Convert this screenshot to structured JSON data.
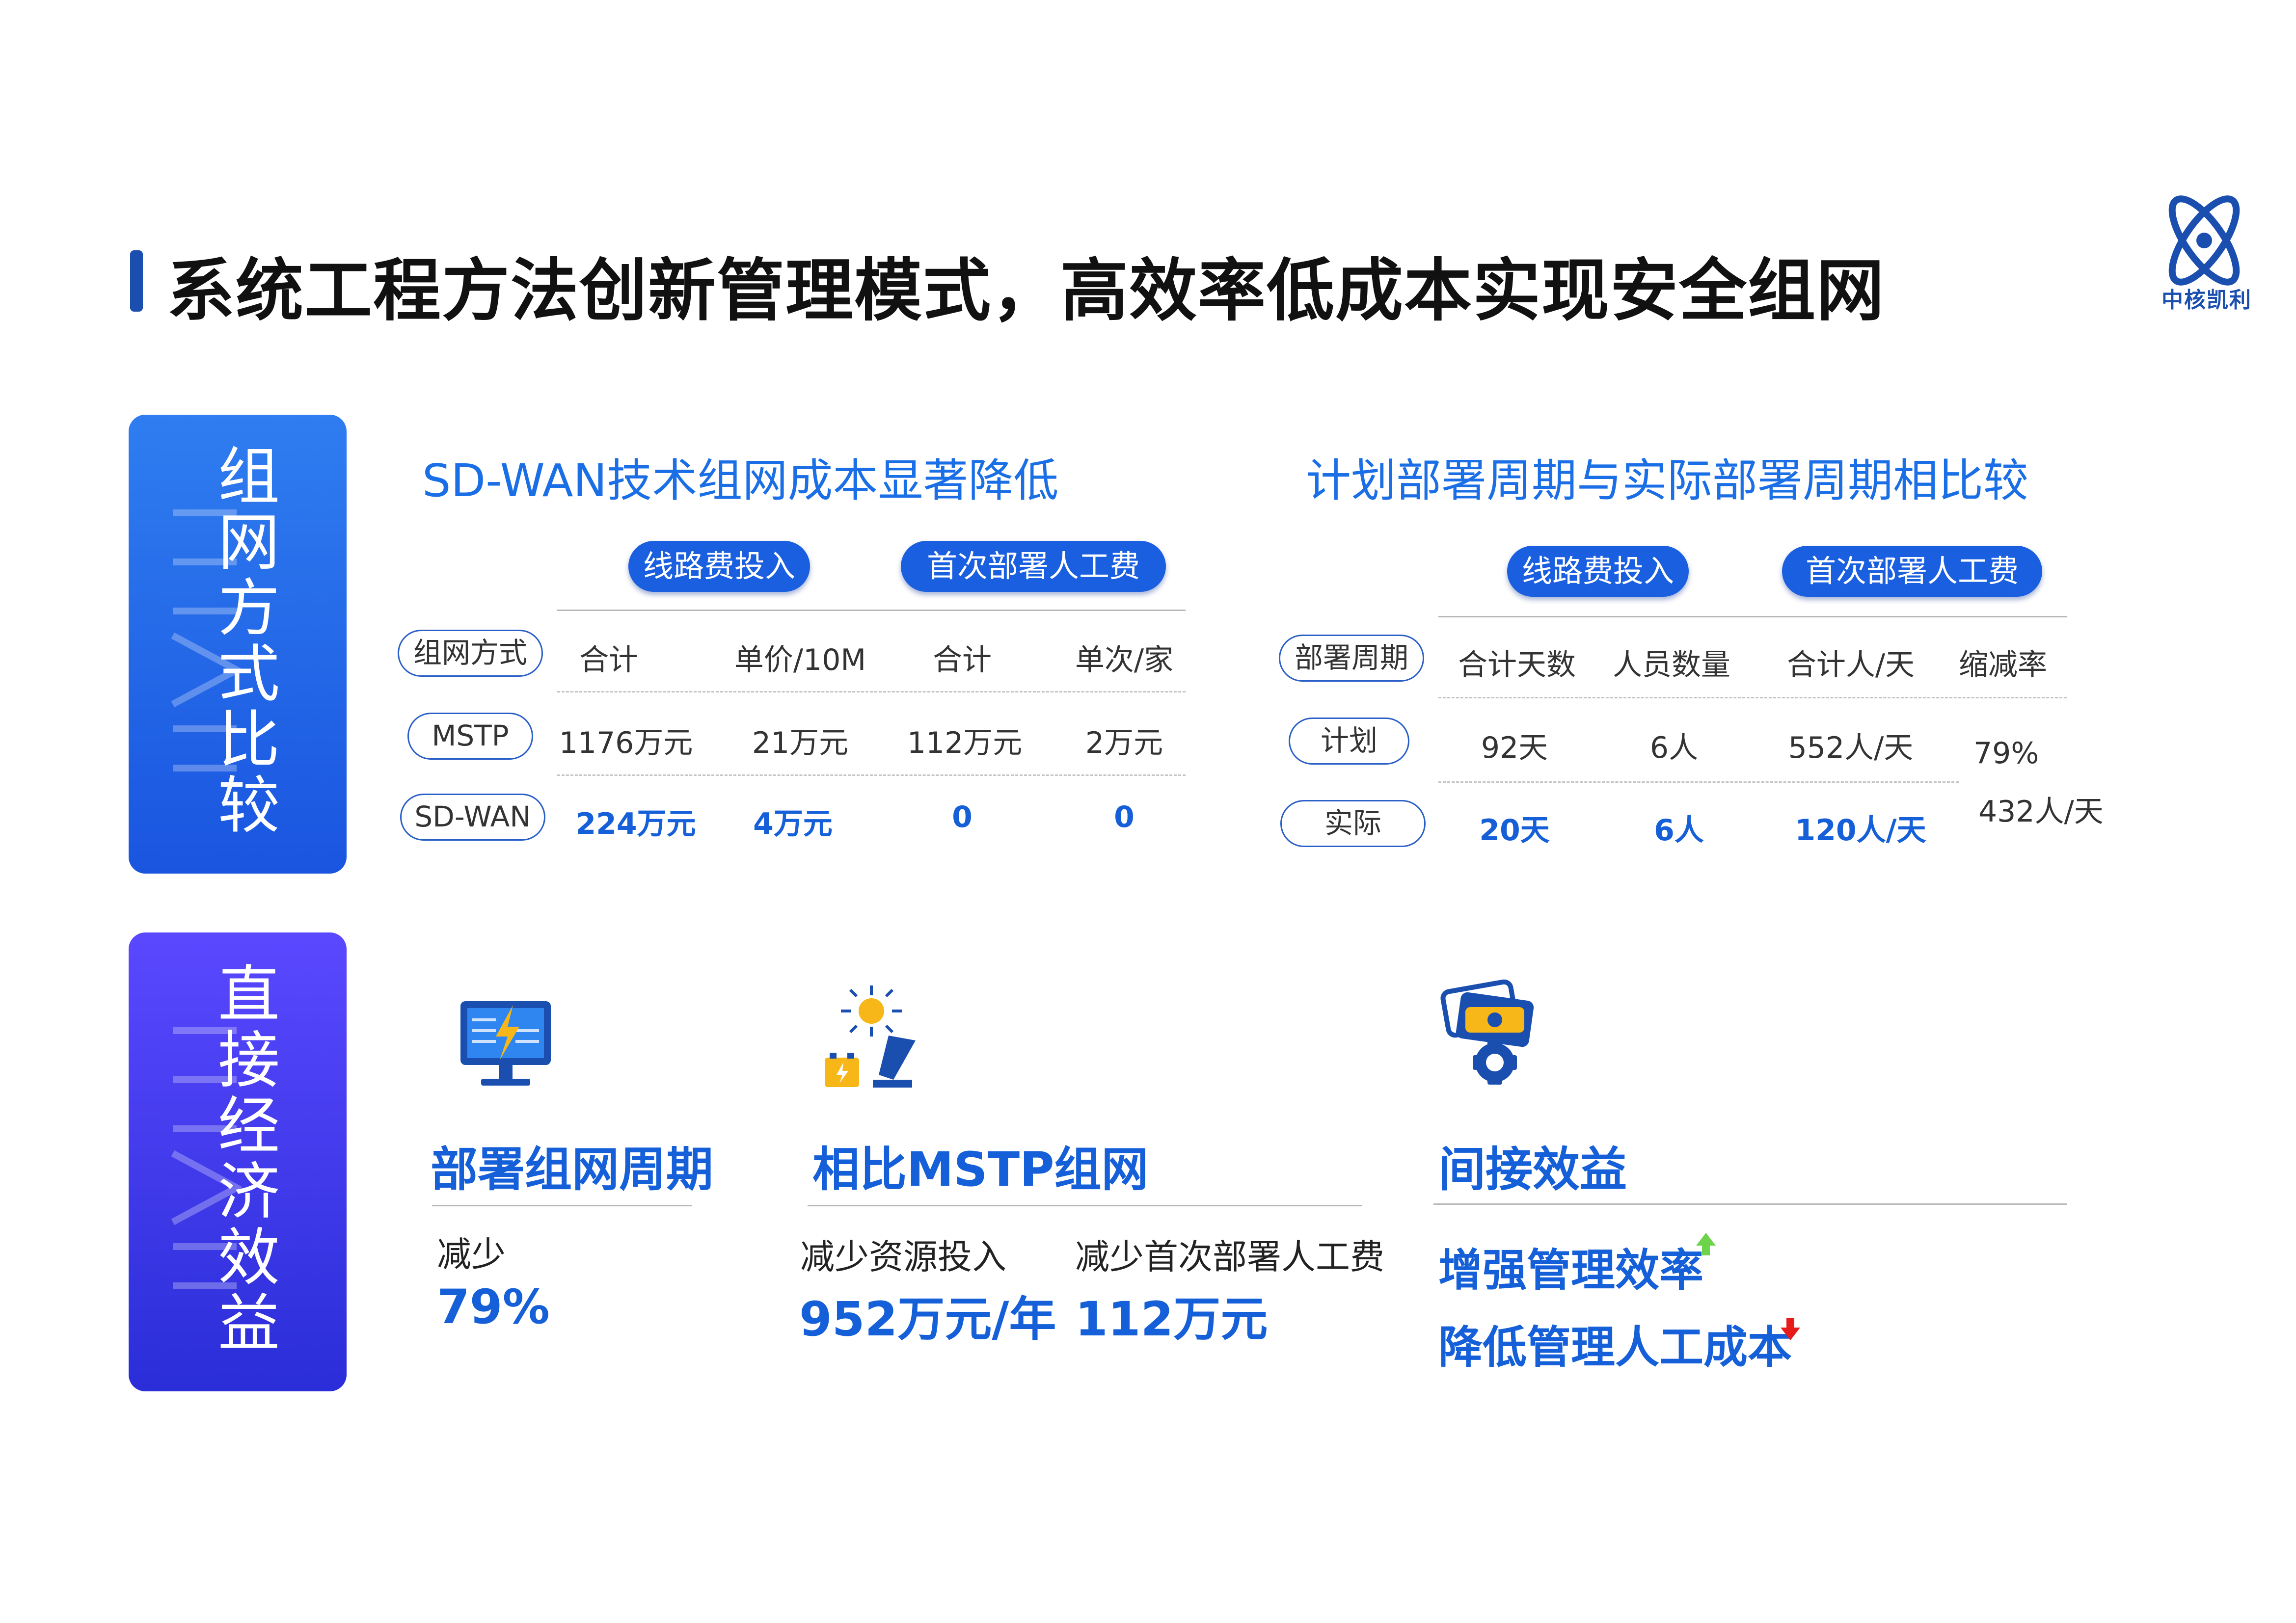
{
  "header": {
    "title": "系统工程方法创新管理模式，高效率低成本实现安全组网",
    "logo_text": "中核凯利"
  },
  "side": {
    "top": [
      "组",
      "网",
      "方",
      "式",
      "比",
      "较"
    ],
    "bottom": [
      "直",
      "接",
      "经",
      "济",
      "效",
      "益"
    ]
  },
  "cost_table": {
    "heading": "SD-WAN技术组网成本显著降低",
    "group_headers": [
      "线路费投入",
      "首次部署人工费"
    ],
    "row_label_header": "组网方式",
    "columns": [
      "合计",
      "单价/10M",
      "合计",
      "单次/家"
    ],
    "rows": [
      {
        "label": "MSTP",
        "values": [
          "1176万元",
          "21万元",
          "112万元",
          "2万元"
        ]
      },
      {
        "label": "SD-WAN",
        "values": [
          "224万元",
          "4万元",
          "0",
          "0"
        ]
      }
    ]
  },
  "cycle_table": {
    "heading": "计划部署周期与实际部署周期相比较",
    "group_headers": [
      "线路费投入",
      "首次部署人工费"
    ],
    "row_label_header": "部署周期",
    "columns": [
      "合计天数",
      "人员数量",
      "合计人/天",
      "缩减率"
    ],
    "rows": [
      {
        "label": "计划",
        "values": [
          "92天",
          "6人",
          "552人/天"
        ]
      },
      {
        "label": "实际",
        "values": [
          "20天",
          "6人",
          "120人/天"
        ]
      }
    ],
    "reduction": [
      "79%",
      "432人/天"
    ]
  },
  "benefits": {
    "cycle": {
      "title": "部署组网周期",
      "label": "减少",
      "value": "79%",
      "icon": "monitor-lightning-icon"
    },
    "mstp": {
      "title": "相比MSTP组网",
      "icon": "solar-battery-icon",
      "items": [
        {
          "label": "减少资源投入",
          "value": "952万元/年"
        },
        {
          "label": "减少首次部署人工费",
          "value": "112万元"
        }
      ]
    },
    "indirect": {
      "title": "间接效益",
      "icon": "money-gear-icon",
      "items": [
        "增强管理效率",
        "降低管理人工成本"
      ]
    }
  },
  "colors": {
    "accent": "#1560d8",
    "panel_top": "#2f7df0",
    "panel_bottom": "#4a3cf6",
    "up": "#6dd34a",
    "down": "#e81b1b"
  }
}
